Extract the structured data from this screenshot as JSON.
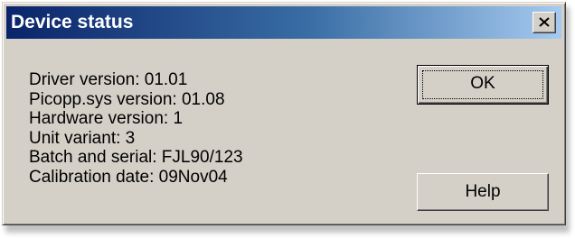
{
  "window": {
    "title": "Device status",
    "close_icon": "close-icon"
  },
  "info": {
    "lines": [
      "Driver version: 01.01",
      "Picopp.sys version: 01.08",
      "Hardware version: 1",
      "Unit variant: 3",
      "Batch and serial: FJL90/123",
      "Calibration date: 09Nov04"
    ]
  },
  "buttons": {
    "ok_label": "OK",
    "help_label": "Help"
  },
  "colors": {
    "title_gradient_start": "#0a246a",
    "title_gradient_end": "#a6caf0",
    "dialog_face": "#d4d0c8",
    "title_text": "#ffffff"
  }
}
